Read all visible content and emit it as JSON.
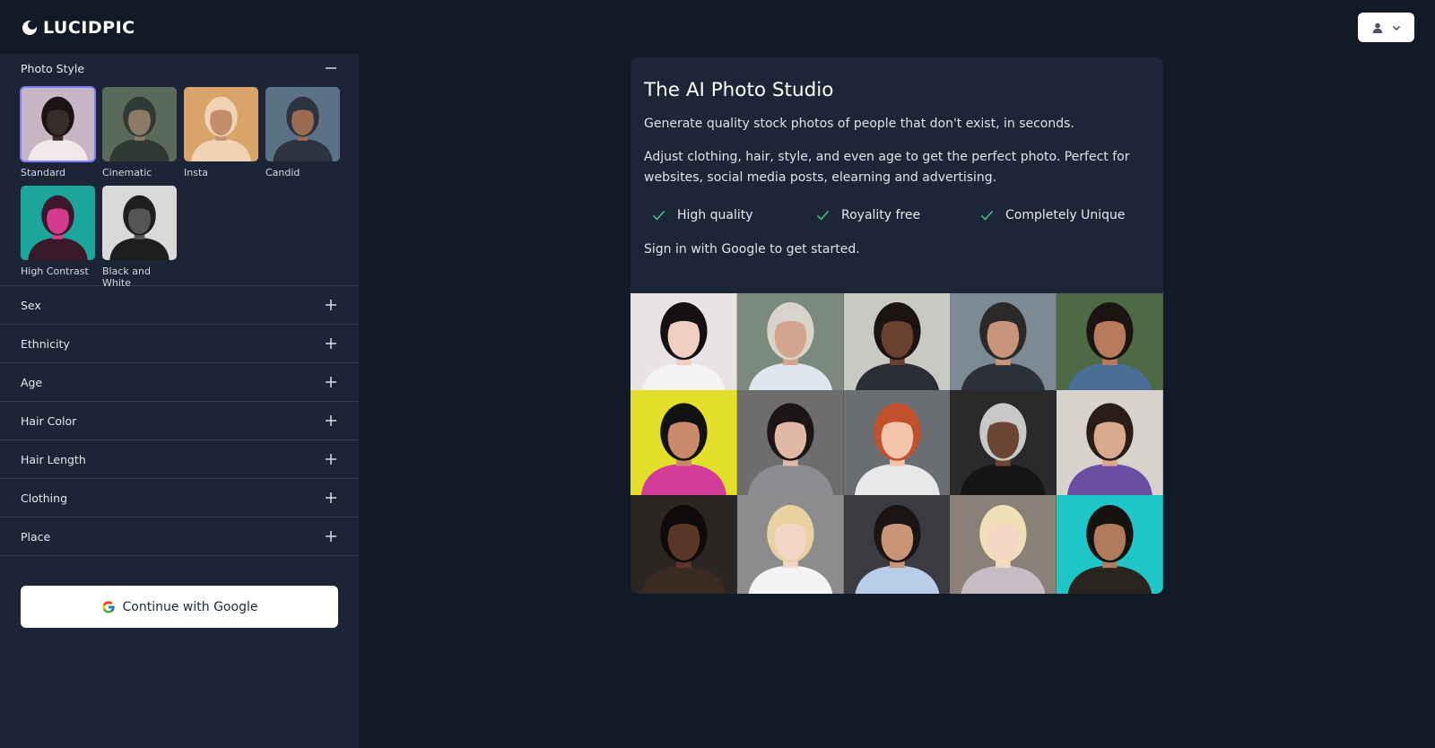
{
  "brand": {
    "name": "LUCIDPIC"
  },
  "header": {
    "user_icon": "user-icon",
    "menu_icon": "chevron-down-icon"
  },
  "sidebar": {
    "photo_style": {
      "title": "Photo Style",
      "toggle": "−",
      "styles": [
        {
          "label": "Standard",
          "selected": true,
          "colors": [
            "#c9b6c4",
            "#3a2b2c",
            "#f1e9e9"
          ]
        },
        {
          "label": "Cinematic",
          "selected": false,
          "colors": [
            "#5a6a5a",
            "#8a7a66",
            "#2e3a33"
          ]
        },
        {
          "label": "Insta",
          "selected": false,
          "colors": [
            "#d9a46a",
            "#c48d6e",
            "#f2d2b4"
          ]
        },
        {
          "label": "Candid",
          "selected": false,
          "colors": [
            "#5b7186",
            "#9b6b52",
            "#2b3440"
          ]
        },
        {
          "label": "High Contrast",
          "selected": false,
          "colors": [
            "#1aa69a",
            "#d63a8c",
            "#3a1a2a"
          ]
        },
        {
          "label": "Black and White",
          "selected": false,
          "colors": [
            "#d9d9d9",
            "#555555",
            "#1e1e1e"
          ]
        }
      ]
    },
    "filters": [
      {
        "label": "Sex"
      },
      {
        "label": "Ethnicity"
      },
      {
        "label": "Age"
      },
      {
        "label": "Hair Color"
      },
      {
        "label": "Hair Length"
      },
      {
        "label": "Clothing"
      },
      {
        "label": "Place"
      }
    ],
    "google_button": {
      "label": "Continue with Google"
    }
  },
  "main": {
    "title": "The AI Photo Studio",
    "paragraph1": "Generate quality stock photos of people that don't exist, in seconds.",
    "paragraph2": "Adjust clothing, hair, style, and even age to get the perfect photo. Perfect for websites, social media posts, elearning and advertising.",
    "features": [
      "High quality",
      "Royality free",
      "Completely Unique"
    ],
    "signin": "Sign in with Google to get started.",
    "photos": [
      {
        "bg": "#e8e4e6",
        "skin": "#f0cfc2",
        "hair": "#141014",
        "cloth": "#f5f2f2"
      },
      {
        "bg": "#7a8a7e",
        "skin": "#d2a58e",
        "hair": "#d8d4cc",
        "cloth": "#dfe6ee"
      },
      {
        "bg": "#c9c9c4",
        "skin": "#6a4030",
        "hair": "#1b1410",
        "cloth": "#2a2d33"
      },
      {
        "bg": "#7d8a94",
        "skin": "#c8957a",
        "hair": "#2a2a2a",
        "cloth": "#2c3038"
      },
      {
        "bg": "#4e6a44",
        "skin": "#b77a5a",
        "hair": "#1a1412",
        "cloth": "#4a6e96"
      },
      {
        "bg": "#e4e02a",
        "skin": "#c88a6a",
        "hair": "#121212",
        "cloth": "#d43c9a"
      },
      {
        "bg": "#6d6d6d",
        "skin": "#e0b8a4",
        "hair": "#1c1616",
        "cloth": "#8c8c90"
      },
      {
        "bg": "#6a6e72",
        "skin": "#f2c4aa",
        "hair": "#c2502a",
        "cloth": "#e8e8ea"
      },
      {
        "bg": "#2a2a2a",
        "skin": "#6b4634",
        "hair": "#c8c8c8",
        "cloth": "#151515"
      },
      {
        "bg": "#d8d2cc",
        "skin": "#d9a98e",
        "hair": "#2a1c16",
        "cloth": "#6a4ea4"
      },
      {
        "bg": "#2a2624",
        "skin": "#5a3626",
        "hair": "#0e0b0a",
        "cloth": "#3a2a22"
      },
      {
        "bg": "#8c8c8c",
        "skin": "#f2d6c6",
        "hair": "#e8d2a2",
        "cloth": "#f4f4f4"
      },
      {
        "bg": "#3a3c42",
        "skin": "#c99478",
        "hair": "#1a1514",
        "cloth": "#b8cde8"
      },
      {
        "bg": "#8a8078",
        "skin": "#f4d6c4",
        "hair": "#f0e0b8",
        "cloth": "#c8bcc4"
      },
      {
        "bg": "#1ec6c8",
        "skin": "#b07a5c",
        "hair": "#161210",
        "cloth": "#2a2420"
      }
    ]
  }
}
